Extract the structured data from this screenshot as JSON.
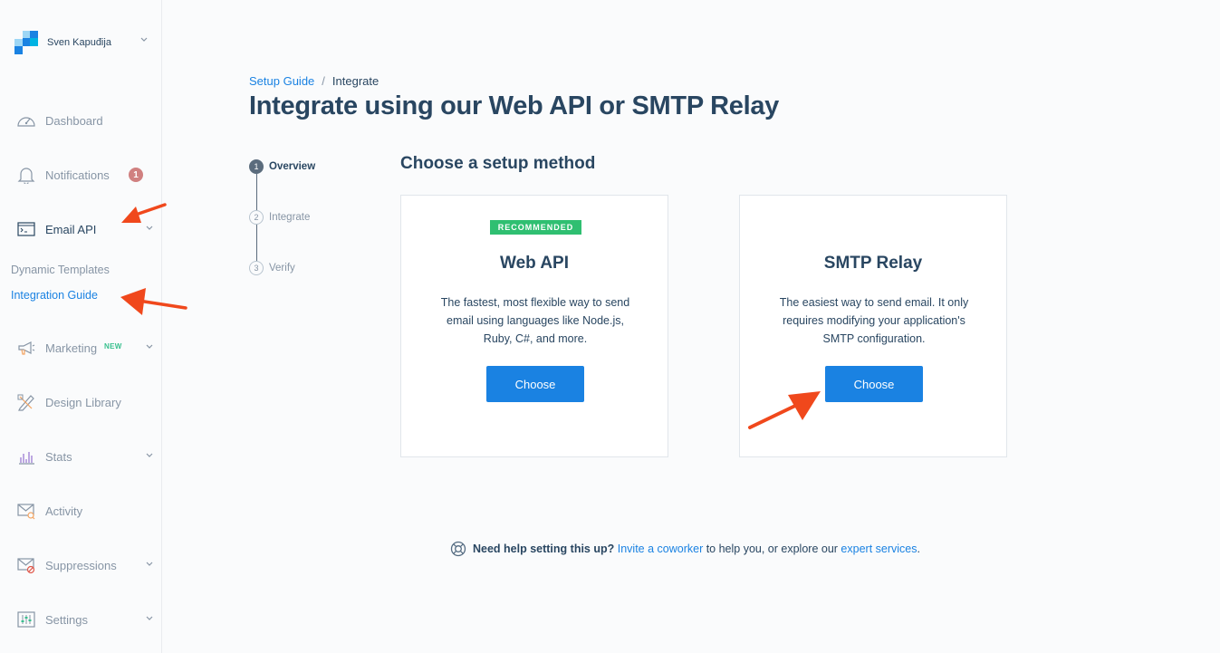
{
  "account": {
    "name": "Sven Kapuđija"
  },
  "sidebar": {
    "items": [
      {
        "label": "Dashboard"
      },
      {
        "label": "Notifications",
        "badge": "1"
      },
      {
        "label": "Email API"
      },
      {
        "label": "Marketing",
        "tag": "NEW"
      },
      {
        "label": "Design Library"
      },
      {
        "label": "Stats"
      },
      {
        "label": "Activity"
      },
      {
        "label": "Suppressions"
      },
      {
        "label": "Settings"
      }
    ],
    "sub_items": [
      {
        "label": "Dynamic Templates"
      },
      {
        "label": "Integration Guide"
      }
    ]
  },
  "breadcrumb": {
    "parent": "Setup Guide",
    "separator": "/",
    "current": "Integrate"
  },
  "page_title": "Integrate using our Web API or SMTP Relay",
  "stepper": [
    {
      "number": "1",
      "label": "Overview"
    },
    {
      "number": "2",
      "label": "Integrate"
    },
    {
      "number": "3",
      "label": "Verify"
    }
  ],
  "section_title": "Choose a setup method",
  "cards": [
    {
      "badge": "RECOMMENDED",
      "title": "Web API",
      "desc_lines": [
        "The fastest, most flexible way to send",
        "email using languages like Node.js,",
        "Ruby, C#, and more."
      ],
      "button": "Choose"
    },
    {
      "title": "SMTP Relay",
      "desc_lines": [
        "The easiest way to send email. It only",
        "requires modifying your application's",
        "SMTP configuration."
      ],
      "button": "Choose"
    }
  ],
  "help": {
    "bold": "Need help setting this up?",
    "link1": "Invite a coworker",
    "mid": " to help you, or explore our ",
    "link2": "expert services",
    "end": "."
  },
  "colors": {
    "accent": "#1a82e2",
    "text": "#294661",
    "muted": "#8795a5",
    "recommended": "#2fbf71",
    "badge": "#d08080",
    "arrow": "#f0481c"
  }
}
